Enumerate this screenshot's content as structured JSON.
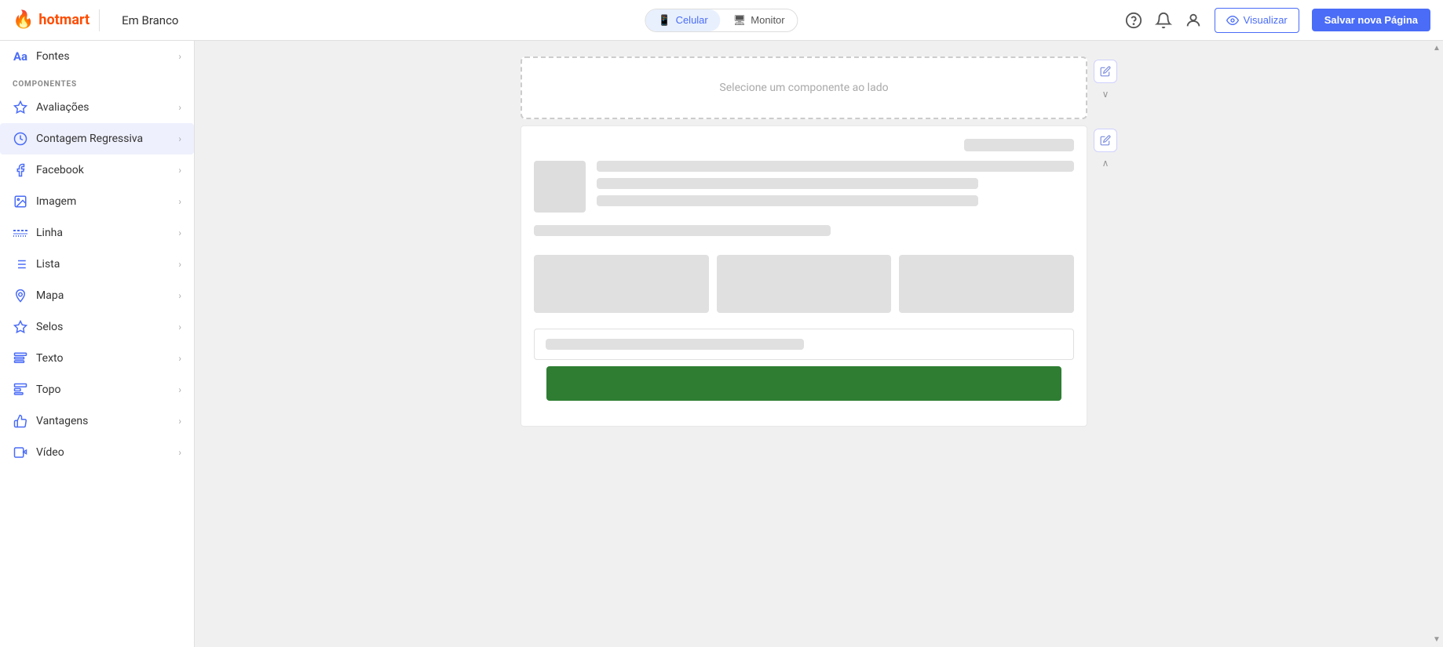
{
  "brand": {
    "name": "hotmart",
    "flame": "🔥"
  },
  "topbar": {
    "page_title": "Em Branco",
    "view_celular": "Celular",
    "view_monitor": "Monitor",
    "btn_visualizar": "Visualizar",
    "btn_salvar": "Salvar nova Página"
  },
  "sidebar": {
    "section_label": "COMPONENTES",
    "item_fontes": "Fontes",
    "item_avaliacoes": "Avaliações",
    "item_contagem": "Contagem Regressiva",
    "item_facebook": "Facebook",
    "item_imagem": "Imagem",
    "item_linha": "Linha",
    "item_lista": "Lista",
    "item_mapa": "Mapa",
    "item_selos": "Selos",
    "item_texto": "Texto",
    "item_topo": "Topo",
    "item_vantagens": "Vantagens",
    "item_video": "Vídeo"
  },
  "canvas": {
    "empty_slot_text": "Selecione um componente ao lado"
  }
}
